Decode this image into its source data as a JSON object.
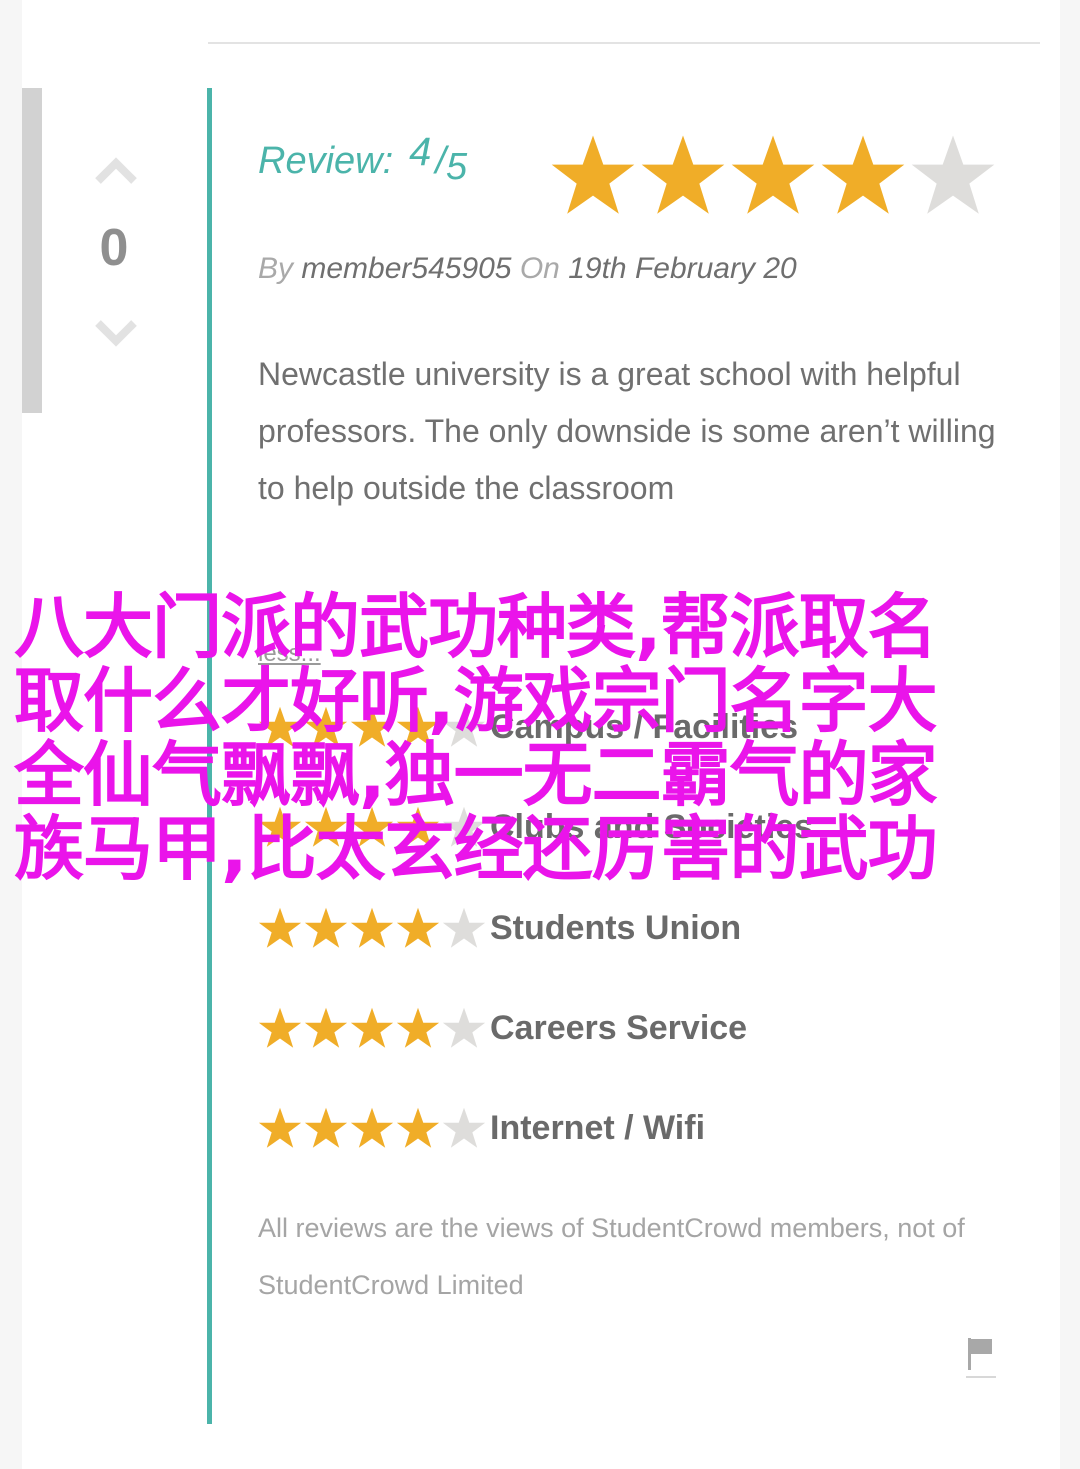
{
  "vote": {
    "count": "0",
    "up_icon": "chevron-up-icon",
    "down_icon": "chevron-down-icon"
  },
  "review": {
    "label": "Review:",
    "score": "4",
    "slash": "/",
    "max": "5",
    "rating_value": 4,
    "rating_max": 5,
    "by_word": "By",
    "author": "member545905",
    "on_word": "On",
    "date": "19th February 20",
    "body": "Newcastle university is a great school with helpful professors. The only downside is some aren’t willing to help outside the classroom",
    "less_link": "less..."
  },
  "ratings": [
    {
      "label": "Campus / Facilities",
      "stars": 4
    },
    {
      "label": "Clubs and Societies",
      "stars": 4
    },
    {
      "label": "Students Union",
      "stars": 4
    },
    {
      "label": "Careers Service",
      "stars": 4
    },
    {
      "label": "Internet / Wifi",
      "stars": 4
    }
  ],
  "disclaimer": "All reviews are the views of StudentCrowd members, not of StudentCrowd Limited",
  "flag_icon": "flag-icon",
  "overlay_lines": [
    "八大门派的武功种类,帮派取名",
    "取什么才好听,游戏宗门名字大",
    "全仙气飘飘,独一无二霸气的家",
    "族马甲,比太玄经还厉害的武功"
  ],
  "colors": {
    "accent": "#4bb4aa",
    "star_on": "#f0ad28",
    "star_off": "#dedddb",
    "overlay": "#ea14ea"
  }
}
